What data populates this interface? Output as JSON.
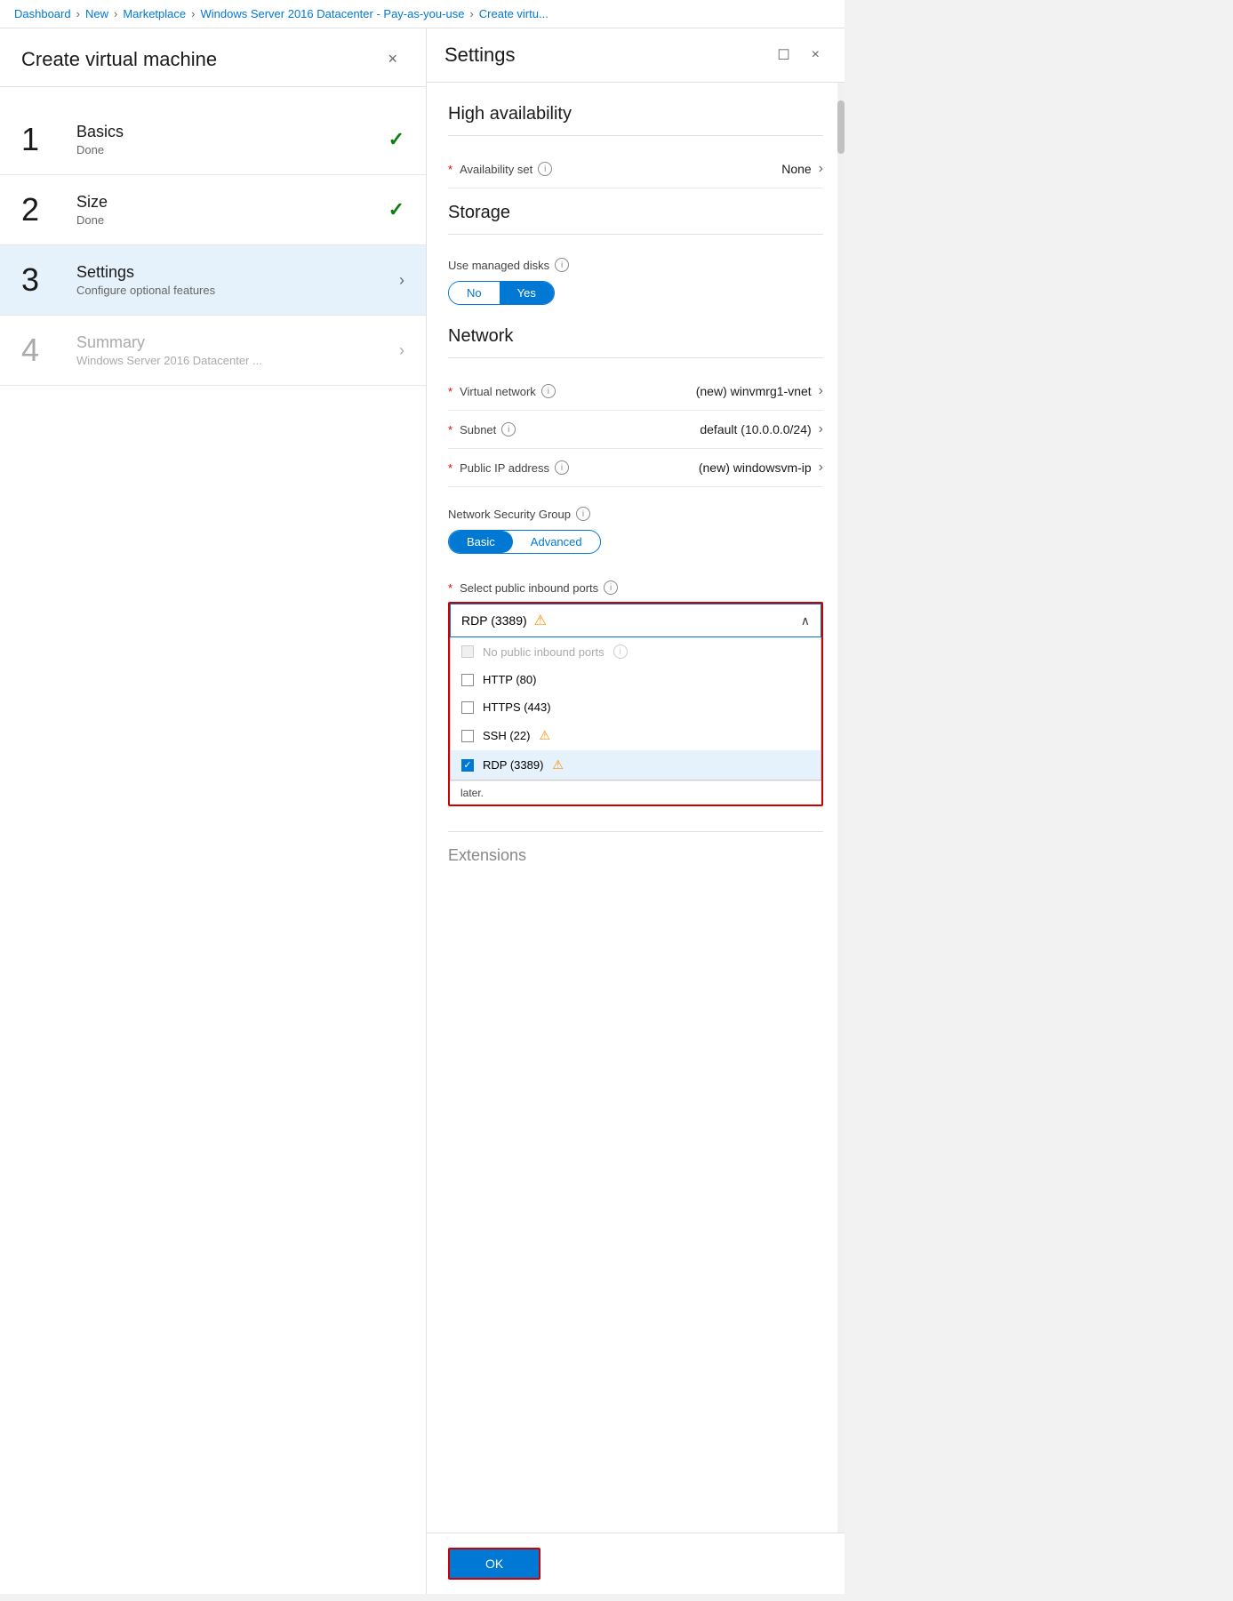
{
  "breadcrumb": {
    "items": [
      "Dashboard",
      "New",
      "Marketplace",
      "Windows Server 2016 Datacenter - Pay-as-you-use",
      "Create virtu..."
    ]
  },
  "left_panel": {
    "title": "Create virtual machine",
    "close_label": "×",
    "steps": [
      {
        "number": "1",
        "title": "Basics",
        "subtitle": "Done",
        "status": "done",
        "active": false
      },
      {
        "number": "2",
        "title": "Size",
        "subtitle": "Done",
        "status": "done",
        "active": false
      },
      {
        "number": "3",
        "title": "Settings",
        "subtitle": "Configure optional features",
        "status": "active",
        "active": true
      },
      {
        "number": "4",
        "title": "Summary",
        "subtitle": "Windows Server 2016 Datacenter ...",
        "status": "inactive",
        "active": false
      }
    ]
  },
  "right_panel": {
    "title": "Settings",
    "sections": {
      "high_availability": {
        "heading": "High availability",
        "availability_set": {
          "label": "Availability set",
          "value": "None",
          "required": true,
          "info": true
        }
      },
      "storage": {
        "heading": "Storage",
        "managed_disks": {
          "label": "Use managed disks",
          "info": true,
          "options": [
            "No",
            "Yes"
          ],
          "selected": "Yes"
        }
      },
      "network": {
        "heading": "Network",
        "virtual_network": {
          "label": "Virtual network",
          "value": "(new) winvmrg1-vnet",
          "required": true,
          "info": true
        },
        "subnet": {
          "label": "Subnet",
          "value": "default (10.0.0.0/24)",
          "required": true,
          "info": true
        },
        "public_ip": {
          "label": "Public IP address",
          "value": "(new) windowsvm-ip",
          "required": true,
          "info": true
        },
        "nsg": {
          "label": "Network Security Group",
          "info": true,
          "options": [
            "Basic",
            "Advanced"
          ],
          "selected": "Basic"
        },
        "inbound_ports": {
          "label": "Select public inbound ports",
          "info": true,
          "required": true,
          "selected_display": "RDP (3389)",
          "warning": true,
          "dropdown_open": true,
          "options": [
            {
              "id": "none",
              "label": "No public inbound ports",
              "checked": false,
              "disabled": true,
              "info": true,
              "warning": false
            },
            {
              "id": "http",
              "label": "HTTP (80)",
              "checked": false,
              "disabled": false,
              "warning": false
            },
            {
              "id": "https",
              "label": "HTTPS (443)",
              "checked": false,
              "disabled": false,
              "warning": false
            },
            {
              "id": "ssh",
              "label": "SSH (22)",
              "checked": false,
              "disabled": false,
              "warning": true
            },
            {
              "id": "rdp",
              "label": "RDP (3389)",
              "checked": true,
              "disabled": false,
              "warning": true
            }
          ]
        }
      },
      "footer_note": "later.",
      "extension": {
        "label": "Extensions"
      }
    },
    "ok_button": "OK"
  }
}
